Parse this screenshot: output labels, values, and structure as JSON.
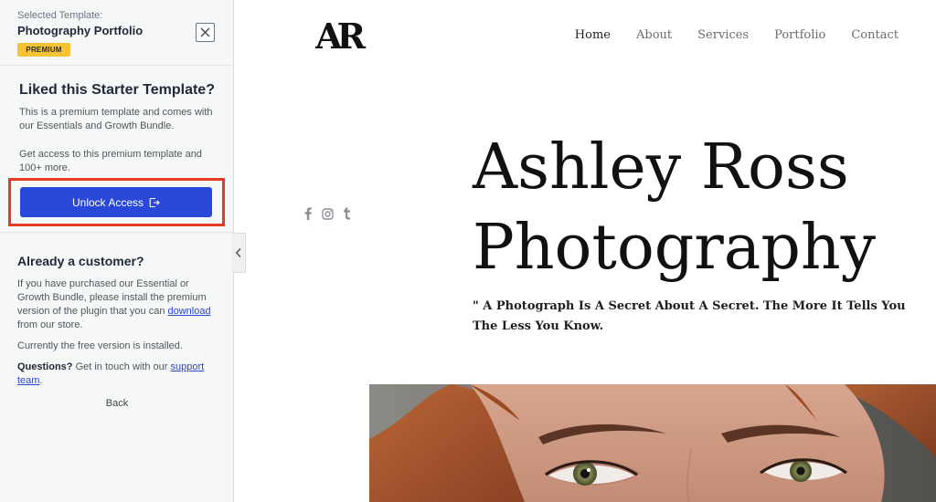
{
  "sidebar": {
    "selected_caption": "Selected Template:",
    "template_name": "Photography Portfolio",
    "badge": "PREMIUM",
    "liked": {
      "title": "Liked this Starter Template?",
      "desc": "This is a premium template and comes with our Essentials and Growth Bundle.",
      "access": "Get access to this premium template and 100+ more.",
      "unlock_label": "Unlock Access"
    },
    "customer": {
      "title": "Already a customer?",
      "para_before": "If you have purchased our Essential or Growth Bundle, please install the premium version of the plugin that you can ",
      "download_link": "download",
      "para_after": " from our store.",
      "free_version": "Currently the free version is installed.",
      "questions_label": "Questions?",
      "questions_text": " Get in touch with our ",
      "support_link": "support team",
      "period": ".",
      "back": "Back"
    }
  },
  "preview": {
    "logo": "AR",
    "nav": [
      "Home",
      "About",
      "Services",
      "Portfolio",
      "Contact"
    ],
    "active_nav": "Home",
    "social_icons": [
      "facebook-icon",
      "instagram-icon",
      "tumblr-icon"
    ],
    "hero_line1": "Ashley Ross",
    "hero_line2": "Photography",
    "quote": "\" A Photograph Is A Secret About A Secret. The More It Tells You The Less You Know."
  },
  "colors": {
    "accent_button": "#2a48d7",
    "highlight": "#e53a24",
    "badge": "#f5c333"
  }
}
